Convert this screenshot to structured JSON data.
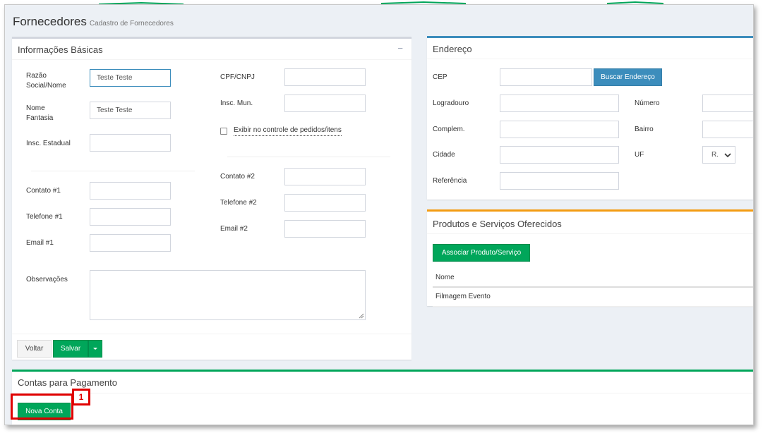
{
  "page": {
    "title": "Fornecedores",
    "subtitle": "Cadastro de Fornecedores"
  },
  "basic_info": {
    "title": "Informações Básicas",
    "collapse_symbol": "−",
    "razao_label": "Razão Social/Nome",
    "razao_value": "Teste Teste",
    "fantasia_label": "Nome Fantasia",
    "fantasia_value": "Teste Teste",
    "insc_estadual_label": "Insc. Estadual",
    "cpf_label": "CPF/CNPJ",
    "insc_mun_label": "Insc. Mun.",
    "exibir_label": "Exibir no controle de pedidos/itens",
    "contato1_label": "Contato #1",
    "telefone1_label": "Telefone #1",
    "email1_label": "Email #1",
    "contato2_label": "Contato #2",
    "telefone2_label": "Telefone #2",
    "email2_label": "Email #2",
    "observacoes_label": "Observações",
    "voltar_label": "Voltar",
    "salvar_label": "Salvar"
  },
  "endereco": {
    "title": "Endereço",
    "cep_label": "CEP",
    "buscar_label": "Buscar Endereço",
    "logradouro_label": "Logradouro",
    "numero_label": "Número",
    "complem_label": "Complem.",
    "bairro_label": "Bairro",
    "cidade_label": "Cidade",
    "uf_label": "UF",
    "uf_value": "R.",
    "referencia_label": "Referência"
  },
  "produtos": {
    "title": "Produtos e Serviços Oferecidos",
    "associar_label": "Associar Produto/Serviço",
    "column_nome": "Nome",
    "rows": [
      "Filmagem Evento"
    ]
  },
  "contas": {
    "title": "Contas para Pagamento",
    "nova_conta_label": "Nova Conta"
  },
  "annotation": {
    "number": "1"
  },
  "colors": {
    "green": "#00a65a",
    "blue": "#3c8dbc",
    "orange": "#f39c12",
    "annotation_red": "#e00000"
  }
}
